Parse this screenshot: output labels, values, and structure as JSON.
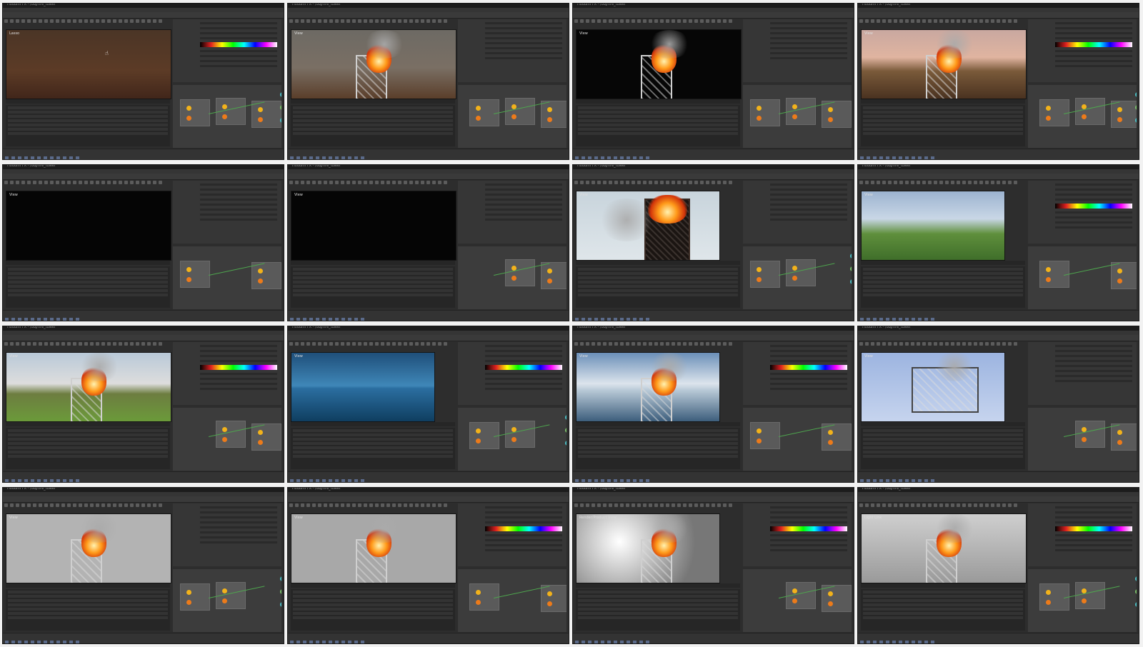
{
  "app": {
    "window_title": "Houdini FX - /obj/fire_tower",
    "menu": [
      "File",
      "Edit",
      "Render",
      "Assets",
      "Windows",
      "Help"
    ],
    "viewer_label": "View"
  },
  "frames": [
    {
      "viewer": "Lasso"
    },
    {
      "viewer": "View"
    },
    {
      "viewer": "View"
    },
    {
      "viewer": "View"
    },
    {
      "viewer": "View"
    },
    {
      "viewer": "View"
    },
    {
      "viewer": "View"
    },
    {
      "viewer": "View"
    },
    {
      "viewer": "View"
    },
    {
      "viewer": "View"
    },
    {
      "viewer": "View"
    },
    {
      "viewer": "View"
    },
    {
      "viewer": "View"
    },
    {
      "viewer": "View"
    },
    {
      "viewer": "Render/Product View"
    },
    {
      "viewer": "Light Link"
    }
  ],
  "colors": {
    "background": "#2d2d2d",
    "node_yellow": "#f2b21b",
    "node_orange": "#ec7b1a",
    "wire_green": "#4ea64e",
    "transport_blue": "#5a6a8a"
  }
}
